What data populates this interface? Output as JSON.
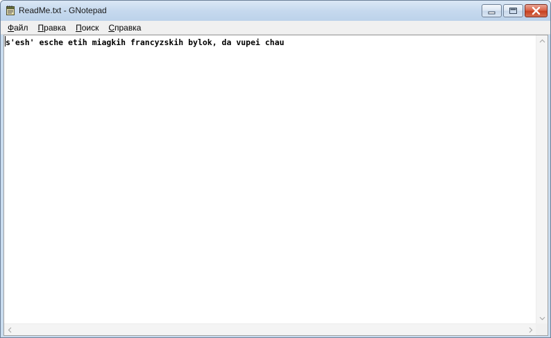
{
  "window": {
    "title": "ReadMe.txt - GNotepad",
    "icon": "notepad-icon",
    "controls": {
      "minimize": "minimize-icon",
      "maximize": "maximize-icon",
      "close": "close-icon"
    }
  },
  "menu": [
    {
      "first": "Ф",
      "rest": "айл"
    },
    {
      "first": "П",
      "rest": "равка"
    },
    {
      "first": "П",
      "rest": "оиск"
    },
    {
      "first": "С",
      "rest": "правка"
    }
  ],
  "editor": {
    "content": "s'esh' esche etih miagkih francyzskih bylok, da vupei chau"
  },
  "scrollbars": {
    "up": "arrow-up-icon",
    "down": "arrow-down-icon",
    "left": "arrow-left-icon",
    "right": "arrow-right-icon"
  },
  "colors": {
    "titlebar": "#c9dcef",
    "close_button": "#c7401f",
    "menubar": "#f0f0f0",
    "editor_bg": "#ffffff"
  }
}
